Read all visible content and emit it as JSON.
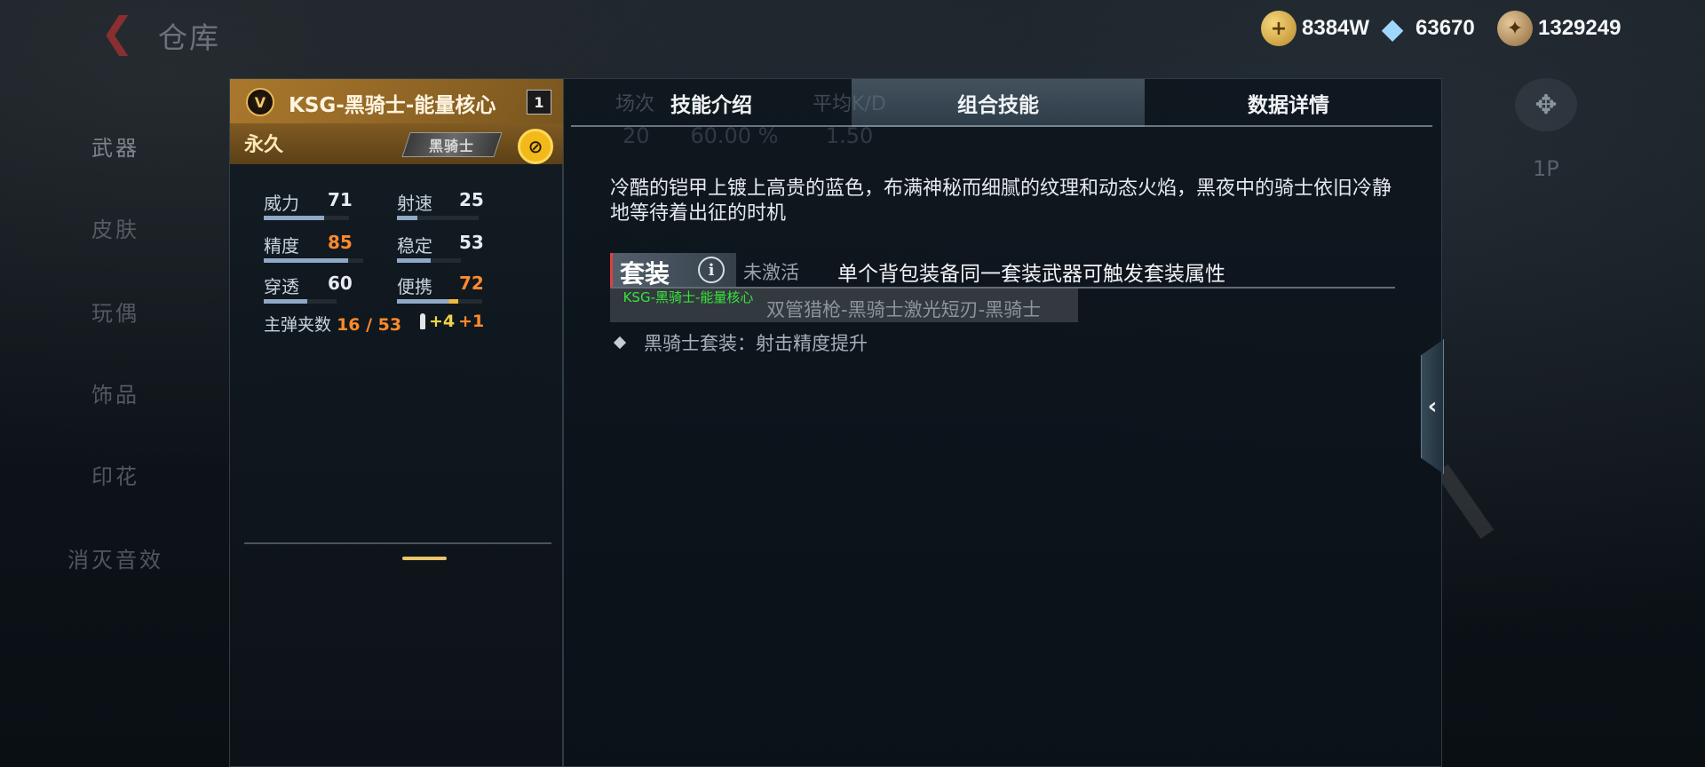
{
  "header": {
    "title": "仓库",
    "currencies": [
      {
        "icon": "gold-coin-icon",
        "value": "8384W"
      },
      {
        "icon": "diamond-icon",
        "value": "63670"
      },
      {
        "icon": "honor-coin-icon",
        "value": "1329249"
      }
    ]
  },
  "nav": {
    "items": [
      "武器",
      "皮肤",
      "玩偶",
      "饰品",
      "印花",
      "消灭音效"
    ],
    "active": "武器"
  },
  "right_ghost": {
    "label": "1P"
  },
  "weapon": {
    "rank_badge": "V",
    "name": "KSG-黑骑士-能量核心",
    "level": "1",
    "duration": "永久",
    "tag": "黑骑士",
    "stats": [
      {
        "label": "威力",
        "value": "71",
        "highlight": false,
        "fill": 0.71
      },
      {
        "label": "射速",
        "value": "25",
        "highlight": false,
        "fill": 0.25
      },
      {
        "label": "精度",
        "value": "85",
        "highlight": true,
        "fill": 0.85
      },
      {
        "label": "稳定",
        "value": "53",
        "highlight": false,
        "fill": 0.53
      },
      {
        "label": "穿透",
        "value": "60",
        "highlight": false,
        "fill": 0.6
      },
      {
        "label": "便携",
        "value": "72",
        "highlight": true,
        "fill": 0.72
      }
    ],
    "ammo_label": "主弹夹数",
    "ammo_value": "16 / 53",
    "ammo_bonus_1": "+4",
    "ammo_bonus_2": "+1"
  },
  "tabs": {
    "items": [
      "技能介绍",
      "组合技能",
      "数据详情"
    ],
    "active": "组合技能",
    "ghost_headers": "场次",
    "ghost_headers_2": "平均K/D",
    "ghost_values": "20      60.00 %       1.50"
  },
  "description": "冷酷的铠甲上镀上高贵的蓝色，布满神秘而细腻的纹理和动态火焰，黑夜中的骑士依旧冷静地等待着出征的时机",
  "suit": {
    "title": "套装",
    "status": "未激活",
    "hint": "单个背包装备同一套装武器可触发套装属性",
    "item_active": "KSG-黑骑士-能量核心",
    "item_others": "双管猎枪-黑骑士激光短刃-黑骑士",
    "bonus": "黑骑士套装：射击精度提升"
  },
  "colors": {
    "accent_gold": "#a8772a",
    "highlight_orange": "#ff8a2b",
    "suit_active_green": "#39e33a"
  }
}
